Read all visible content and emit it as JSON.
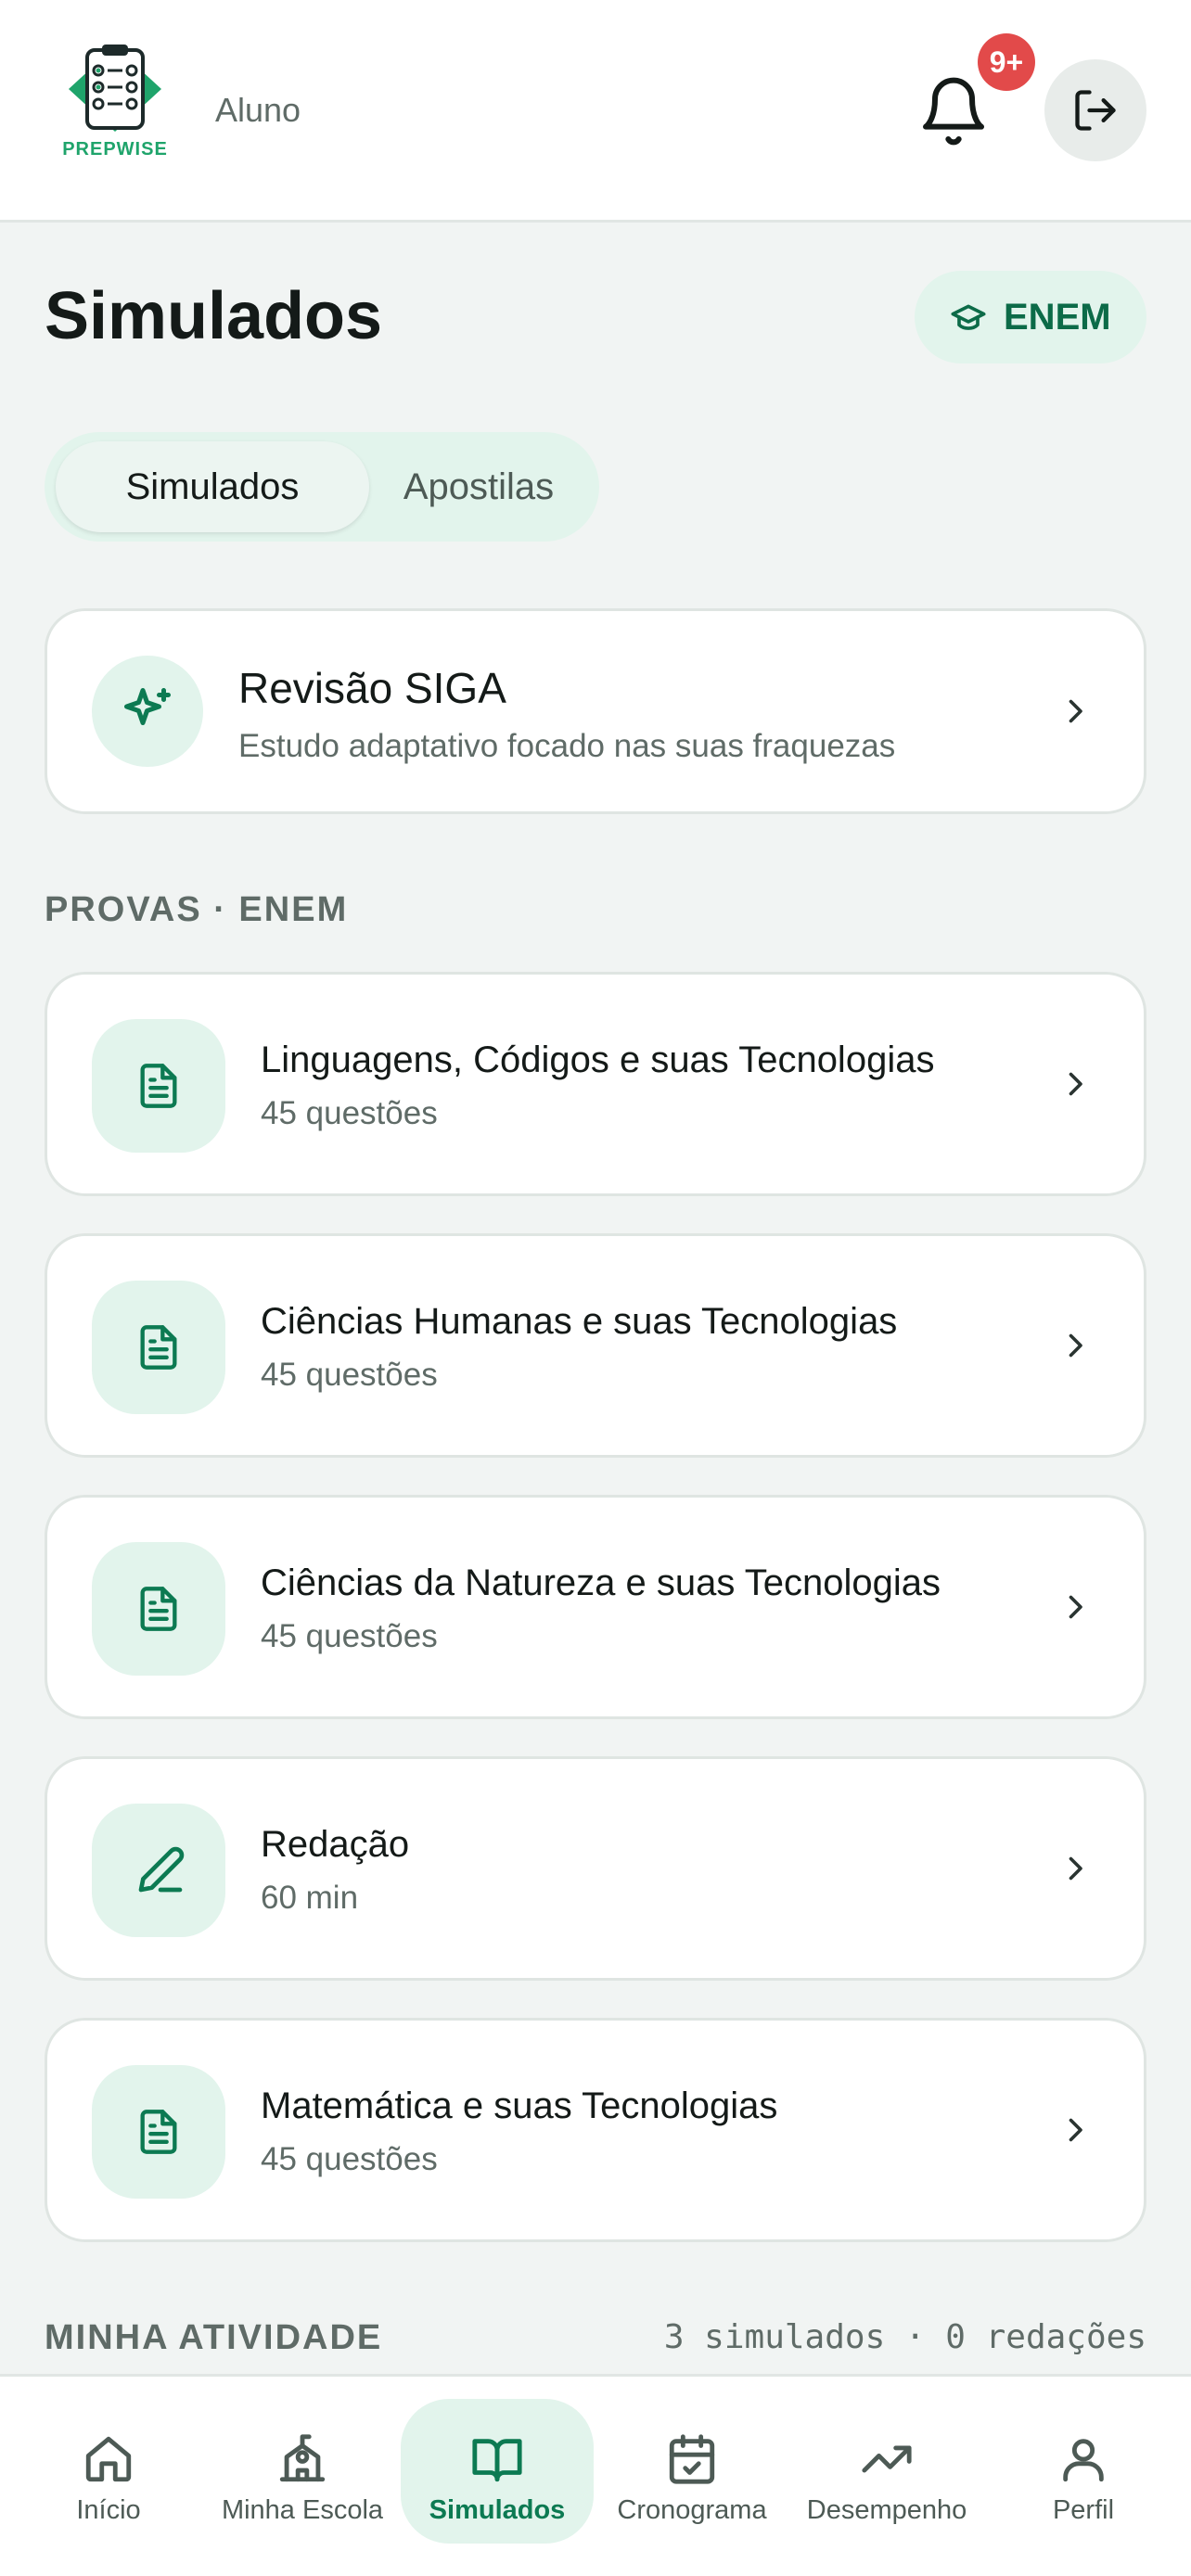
{
  "header": {
    "logo_text": "PREPWISE",
    "role": "Aluno",
    "notification_badge": "9+"
  },
  "page": {
    "title": "Simulados",
    "exam_selector": "ENEM"
  },
  "tabs": [
    {
      "label": "Simulados",
      "active": true
    },
    {
      "label": "Apostilas",
      "active": false
    }
  ],
  "siga": {
    "title": "Revisão SIGA",
    "subtitle": "Estudo adaptativo focado nas suas fraquezas"
  },
  "provas": {
    "section_label": "PROVAS · ENEM",
    "items": [
      {
        "title": "Linguagens, Códigos e suas Tecnologias",
        "subtitle": "45 questões",
        "icon": "document-icon"
      },
      {
        "title": "Ciências Humanas e suas Tecnologias",
        "subtitle": "45 questões",
        "icon": "document-icon"
      },
      {
        "title": "Ciências da Natureza e suas Tecnologias",
        "subtitle": "45 questões",
        "icon": "document-icon"
      },
      {
        "title": "Redação",
        "subtitle": "60 min",
        "icon": "pencil-icon"
      },
      {
        "title": "Matemática e suas Tecnologias",
        "subtitle": "45 questões",
        "icon": "document-icon"
      }
    ]
  },
  "activity": {
    "label": "MINHA ATIVIDADE",
    "stats": "3 simulados · 0 redações"
  },
  "nav": [
    {
      "label": "Início",
      "icon": "home-icon",
      "active": false
    },
    {
      "label": "Minha Escola",
      "icon": "school-icon",
      "active": false
    },
    {
      "label": "Simulados",
      "icon": "book-icon",
      "active": true
    },
    {
      "label": "Cronograma",
      "icon": "calendar-icon",
      "active": false
    },
    {
      "label": "Desempenho",
      "icon": "trending-up-icon",
      "active": false
    },
    {
      "label": "Perfil",
      "icon": "user-icon",
      "active": false
    }
  ],
  "colors": {
    "accent": "#0c7a52",
    "accent_light": "#e2f4ec",
    "badge": "#e24a4a",
    "background": "#f1f4f3"
  }
}
